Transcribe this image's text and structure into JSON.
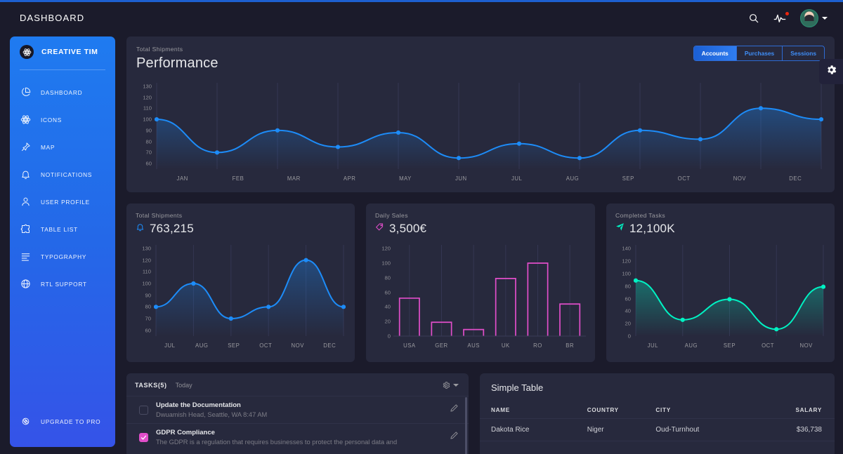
{
  "header": {
    "title": "DASHBOARD",
    "search_icon": "search-icon",
    "activity_icon": "pulse-activity-icon",
    "avatar_icon": "user-avatar"
  },
  "sidebar": {
    "brand": "CREATIVE TIM",
    "brand_icon": "atom-logo-icon",
    "items": [
      {
        "label": "DASHBOARD",
        "icon": "pie-chart-icon"
      },
      {
        "label": "ICONS",
        "icon": "atom-icon"
      },
      {
        "label": "MAP",
        "icon": "pin-icon"
      },
      {
        "label": "NOTIFICATIONS",
        "icon": "bell-icon"
      },
      {
        "label": "USER PROFILE",
        "icon": "person-icon"
      },
      {
        "label": "TABLE LIST",
        "icon": "puzzle-icon"
      },
      {
        "label": "TYPOGRAPHY",
        "icon": "text-lines-icon"
      },
      {
        "label": "RTL SUPPORT",
        "icon": "globe-icon"
      }
    ],
    "upgrade": {
      "label": "UPGRADE TO PRO",
      "icon": "rocket-icon"
    }
  },
  "settings_fab": {
    "icon": "gear-icon"
  },
  "performance": {
    "subtitle": "Total Shipments",
    "title": "Performance",
    "buttons": [
      {
        "label": "Accounts",
        "active": true
      },
      {
        "label": "Purchases",
        "active": false
      },
      {
        "label": "Sessions",
        "active": false
      }
    ]
  },
  "stats": [
    {
      "subtitle": "Total Shipments",
      "value": "763,215",
      "icon": "bell-icon",
      "color": "#1d8cf8"
    },
    {
      "subtitle": "Daily Sales",
      "value": "3,500€",
      "icon": "tag-icon",
      "color": "#e14eca"
    },
    {
      "subtitle": "Completed Tasks",
      "value": "12,100K",
      "icon": "send-icon",
      "color": "#00f2c3"
    }
  ],
  "tasks": {
    "title": "TASKS(5)",
    "subtitle": "Today",
    "gear_icon": "gear-icon",
    "items": [
      {
        "name": "Update the Documentation",
        "desc": "Dwuamish Head, Seattle, WA 8:47 AM",
        "checked": false,
        "edit_icon": "pencil-icon"
      },
      {
        "name": "GDPR Compliance",
        "desc": "The GDPR is a regulation that requires businesses to protect the personal data and",
        "checked": true,
        "edit_icon": "pencil-icon"
      }
    ]
  },
  "table": {
    "title": "Simple Table",
    "columns": [
      "NAME",
      "COUNTRY",
      "CITY",
      "SALARY"
    ],
    "rows": [
      [
        "Dakota Rice",
        "Niger",
        "Oud-Turnhout",
        "$36,738"
      ]
    ]
  },
  "chart_data": [
    {
      "type": "line",
      "title": "Performance",
      "name": "performance-chart",
      "categories": [
        "JAN",
        "FEB",
        "MAR",
        "APR",
        "MAY",
        "JUN",
        "JUL",
        "AUG",
        "SEP",
        "OCT",
        "NOV",
        "DEC"
      ],
      "values": [
        100,
        70,
        90,
        75,
        88,
        65,
        78,
        65,
        90,
        82,
        110,
        100
      ],
      "yticks": [
        130,
        120,
        110,
        100,
        90,
        80,
        70,
        60
      ],
      "ylim": [
        55,
        133
      ],
      "xlabel": "",
      "ylabel": "",
      "grid": true,
      "legend": null,
      "color": "#1d8cf8"
    },
    {
      "type": "line",
      "title": "Total Shipments",
      "name": "total-shipments-chart",
      "categories": [
        "JUL",
        "AUG",
        "SEP",
        "OCT",
        "NOV",
        "DEC"
      ],
      "values": [
        80,
        100,
        70,
        80,
        120,
        80
      ],
      "yticks": [
        130,
        120,
        110,
        100,
        90,
        80,
        70,
        60
      ],
      "ylim": [
        55,
        133
      ],
      "xlabel": "",
      "ylabel": "",
      "grid": true,
      "legend": null,
      "color": "#1d8cf8"
    },
    {
      "type": "bar",
      "title": "Daily Sales",
      "name": "daily-sales-chart",
      "categories": [
        "USA",
        "GER",
        "AUS",
        "UK",
        "RO",
        "BR"
      ],
      "values": [
        52,
        19,
        9,
        79,
        100,
        44
      ],
      "yticks": [
        120,
        100,
        80,
        60,
        40,
        20,
        0
      ],
      "ylim": [
        0,
        125
      ],
      "xlabel": "",
      "ylabel": "",
      "grid": true,
      "legend": null,
      "color": "#e14eca"
    },
    {
      "type": "line",
      "title": "Completed Tasks",
      "name": "completed-tasks-chart",
      "categories": [
        "JUL",
        "AUG",
        "SEP",
        "OCT",
        "NOV"
      ],
      "values": [
        89,
        26,
        59,
        11,
        79
      ],
      "yticks": [
        140,
        120,
        100,
        80,
        60,
        40,
        20,
        0
      ],
      "ylim": [
        0,
        146
      ],
      "xlabel": "",
      "ylabel": "",
      "grid": true,
      "legend": null,
      "color": "#00f2c3"
    }
  ]
}
